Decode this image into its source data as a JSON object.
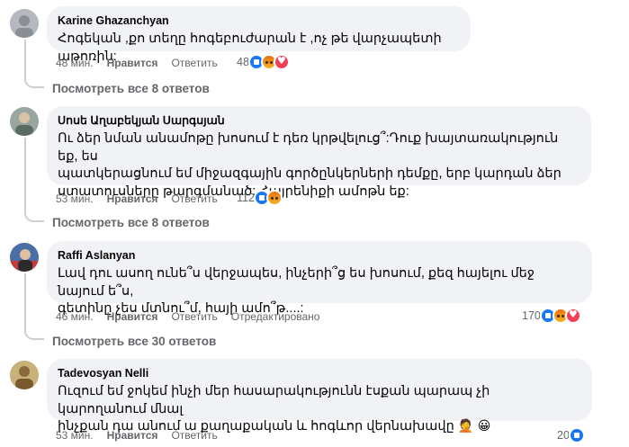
{
  "comments": [
    {
      "author": "Karine Ghazanchyan",
      "text": "Հոգեկան ,քո տեղը հոգեբուժարան է ,ոչ թե վարչապետի աթոռին:",
      "time": "48 мин.",
      "like": "Нравится",
      "reply": "Ответить",
      "reaction_count": "48",
      "reactions": [
        "like-icon",
        "angry-icon",
        "love-icon"
      ],
      "view_replies": "Посмотреть все 8 ответов"
    },
    {
      "author": "Սոսե Աղաբեկյան Սարգսյան",
      "text_lines": [
        "Ու ձեր նման անամոթը խոսում է դեռ կրթվելուց՞:Դուք խայտառակություն եք, ես",
        "պատկերացնում եմ միջազգային գործընկերների դեմքը, երբ կարդան ձեր",
        "ստատուսները թարգմանած: Հայրենիքի ամոթն եք:"
      ],
      "time": "53 мин.",
      "like": "Нравится",
      "reply": "Ответить",
      "reaction_count": "112",
      "reactions": [
        "like-icon",
        "angry-icon"
      ],
      "view_replies": "Посмотреть все 8 ответов"
    },
    {
      "author": "Raffi Aslanyan",
      "text_lines": [
        "Լավ դու ասող ունե՞ս վերջապես, ինչերի՞ց ես խոսում, քեզ հայելու մեջ նայում ե՞ս,",
        "գետինը չես մտնու՞մ, հայի ամո՞թ....:"
      ],
      "time": "46 мин.",
      "like": "Нравится",
      "reply": "Ответить",
      "edited": "Отредактировано",
      "reaction_count": "170",
      "reactions": [
        "like-icon",
        "angry-icon",
        "love-icon"
      ],
      "view_replies": "Посмотреть все 30 ответов"
    },
    {
      "author": "Tadevosyan Nelli",
      "text_lines": [
        "Ուզում եմ ջոկեմ ինչի մեր հասարակությունն էսքան պարապ չի կարողանում մնալ",
        "ինչքան դա անում ա քաղաքական և հոգևոր վերնախավը"
      ],
      "emojis": "🤦 😀",
      "time": "53 мин.",
      "like": "Нравится",
      "reply": "Ответить",
      "reaction_count": "20",
      "reactions": [
        "like-icon"
      ]
    }
  ],
  "colors": {
    "bubble": "#f0f2f5",
    "meta": "#65676b",
    "like": "#1877f2",
    "love": "#f33e58",
    "angry": "#f7b125"
  }
}
